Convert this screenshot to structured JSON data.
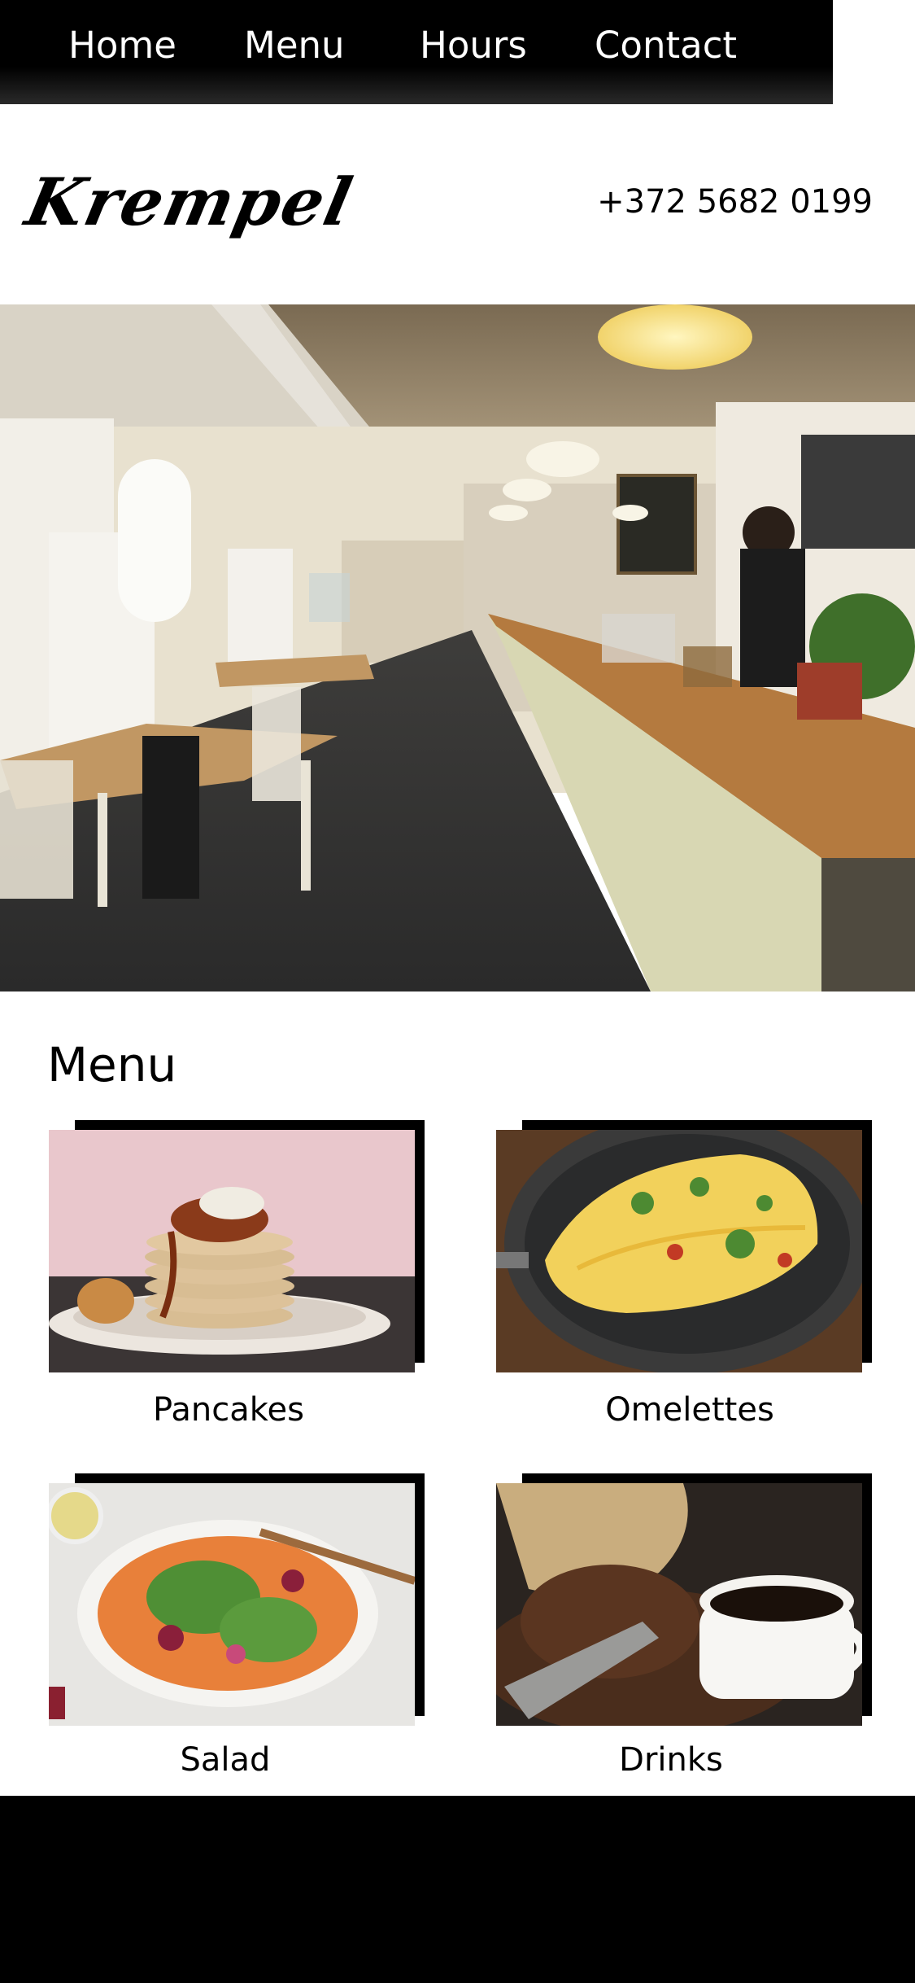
{
  "nav": {
    "items": [
      {
        "label": "Home"
      },
      {
        "label": "Menu"
      },
      {
        "label": "Hours"
      },
      {
        "label": "Contact"
      }
    ]
  },
  "header": {
    "logo_text": "Krempel",
    "phone": "+372 5682 0199"
  },
  "menu": {
    "heading": "Menu",
    "items": [
      {
        "label": "Pancakes",
        "image": "pancakes-photo"
      },
      {
        "label": "Omelettes",
        "image": "omelette-photo"
      },
      {
        "label": "Salad",
        "image": "salad-photo"
      },
      {
        "label": "Drinks",
        "image": "coffee-photo"
      }
    ]
  },
  "colors": {
    "nav_background": "#000000",
    "nav_text": "#ffffff",
    "page_background": "#ffffff",
    "footer_background": "#000000"
  }
}
